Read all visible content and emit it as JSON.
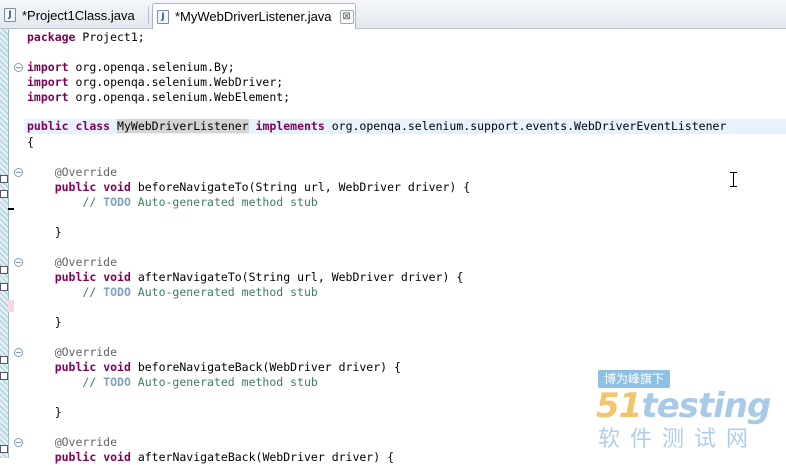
{
  "tabs": [
    {
      "label": "*Project1Class.java",
      "icon": "java-file-icon",
      "active": false
    },
    {
      "label": "*MyWebDriverListener.java",
      "icon": "java-file-icon",
      "active": true,
      "close": "⊠"
    }
  ],
  "code": {
    "package": {
      "kw": "package",
      "rest": " Project1;"
    },
    "imports": [
      {
        "kw": "import",
        "rest": " org.openqa.selenium.By;"
      },
      {
        "kw": "import",
        "rest": " org.openqa.selenium.WebDriver;"
      },
      {
        "kw": "import",
        "rest": " org.openqa.selenium.WebElement;"
      }
    ],
    "class_decl": {
      "kw1": "public",
      "kw2": "class",
      "name": "MyWebDriverListener",
      "kw3": "implements",
      "iface": " org.openqa.selenium.support.events.WebDriverEventListener"
    },
    "open_brace": "{",
    "annotation": "@Override",
    "methods": [
      {
        "sig": "beforeNavigateTo(String url, WebDriver driver) {"
      },
      {
        "sig": "afterNavigateTo(String url, WebDriver driver) {"
      },
      {
        "sig": "beforeNavigateBack(WebDriver driver) {"
      },
      {
        "sig": "afterNavigateBack(WebDriver driver) {"
      }
    ],
    "pub": "public",
    "void": "void",
    "comment_prefix": "// ",
    "todo": "TODO",
    "comment_rest": " Auto-generated method stub",
    "close_brace": "}"
  },
  "watermark": {
    "banner": "博为峰旗下",
    "logo_51": "51",
    "logo_testing": "testing",
    "subtitle": "软件测试网"
  },
  "colors": {
    "keyword": "#7f0055",
    "annotation": "#646464",
    "comment": "#3f7f5f",
    "todo": "#7f9fbf",
    "current_line": "#e8f2fe"
  }
}
